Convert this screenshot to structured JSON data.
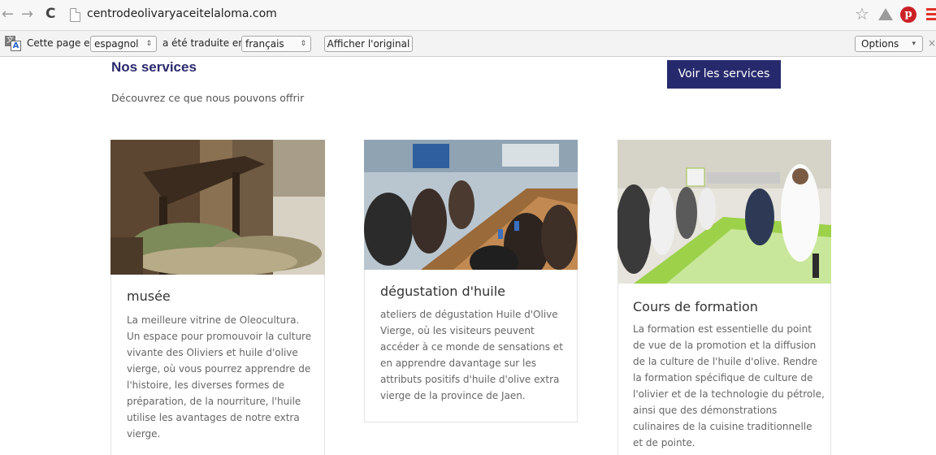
{
  "browser": {
    "url": "centrodeolivaryaceitelaloma.com",
    "back_glyph": "←",
    "forward_glyph": "→",
    "reload_glyph": "C",
    "star_glyph": "☆",
    "pinterest_glyph": "p"
  },
  "translate_bar": {
    "prefix": "Cette page en",
    "source_language": "espagnol",
    "middle": "a été traduite en",
    "target_language": "français",
    "show_original": "Afficher l'original",
    "options": "Options",
    "close_glyph": "×",
    "select_arrow": "⇕",
    "options_arrow": "▾",
    "icon_back_letter": "文",
    "icon_front_letter": "A"
  },
  "header": {
    "title": "Nos services",
    "subtitle": "Découvrez ce que nous pouvons offrir",
    "button": "Voir les services"
  },
  "cards": [
    {
      "title": "musée",
      "text": "La meilleure vitrine de Oleocultura. Un espace pour promouvoir la culture vivante des Oliviers et huile d'olive vierge, où vous pourrez apprendre de l'histoire, les diverses formes de préparation, de la nourriture, l'huile utilise les avantages de notre extra vierge."
    },
    {
      "title": "dégustation d'huile",
      "text": "ateliers de dégustation Huile d'Olive Vierge, où les visiteurs peuvent accéder à ce monde de sensations et en apprendre davantage sur les attributs positifs d'huile d'olive extra vierge de la province de Jaen."
    },
    {
      "title": "Cours de formation",
      "text": "La formation est essentielle du point de vue de la promotion et la diffusion de la culture de l'huile d'olive. Rendre la formation spécifique de culture de l'olivier et de la technologie du pétrole, ainsi que des démonstrations culinaires de la cuisine traditionnelle et de pointe."
    }
  ],
  "colors": {
    "brand_navy": "#262a6d",
    "title_navy": "#2a2a6e",
    "pinterest_red": "#cb2027",
    "menu_red": "#e0332b"
  }
}
